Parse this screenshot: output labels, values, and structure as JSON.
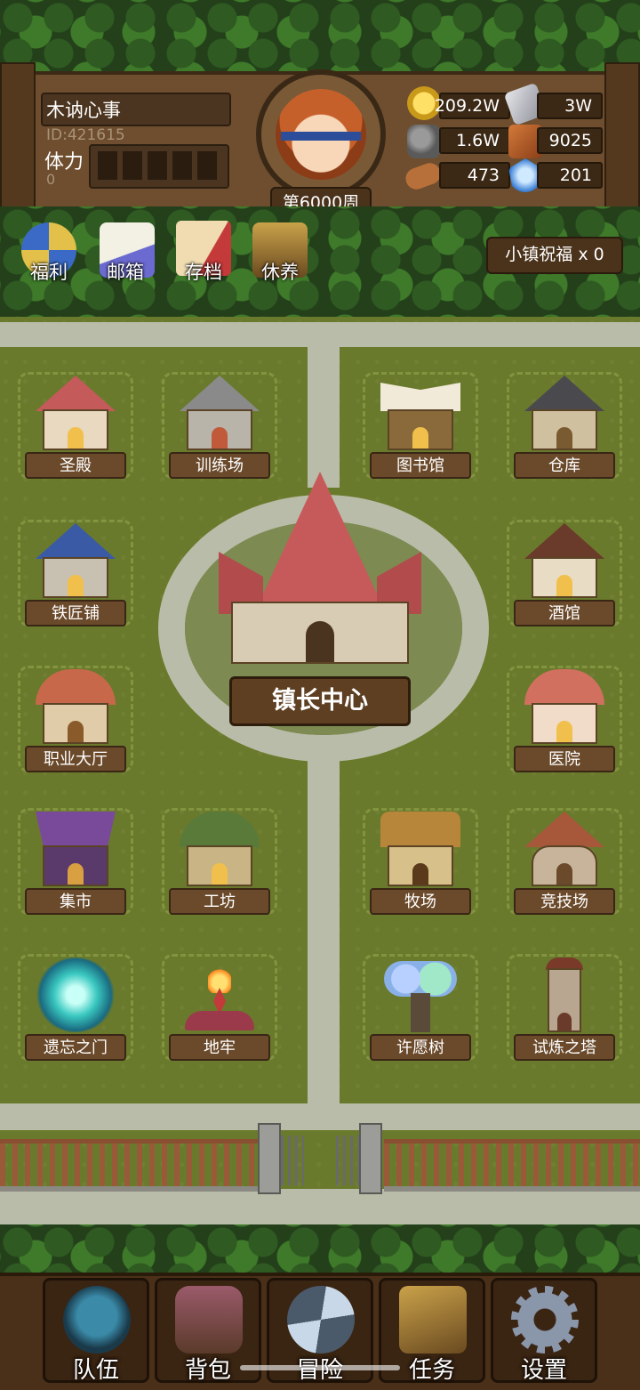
{
  "player": {
    "name": "木讷心事",
    "id": "ID:421615",
    "stamina_label": "体力",
    "stamina_value": "0",
    "week": "第6000周"
  },
  "resources": {
    "gold": "209.2W",
    "iron": "3W",
    "stone": "1.6W",
    "ore": "9025",
    "wood": "473",
    "crystal": "201"
  },
  "top_menu": [
    "福利",
    "邮箱",
    "存档",
    "休养"
  ],
  "blessing": "小镇祝福 x 0",
  "buildings": {
    "shrine": "圣殿",
    "training": "训练场",
    "library": "图书馆",
    "warehouse": "仓库",
    "smithy": "铁匠铺",
    "tavern": "酒馆",
    "guild": "职业大厅",
    "hospital": "医院",
    "market": "集市",
    "workshop": "工坊",
    "ranch": "牧场",
    "arena": "竞技场",
    "portal": "遗忘之门",
    "dungeon": "地牢",
    "wishtree": "许愿树",
    "tower": "试炼之塔",
    "center": "镇长中心"
  },
  "bottom_nav": [
    "队伍",
    "背包",
    "冒险",
    "任务",
    "设置"
  ],
  "colors": {
    "grass": "#6a7a2c",
    "path": "#b9bca8",
    "wood": "#6b4a2b",
    "gold": "#f1c04c"
  }
}
